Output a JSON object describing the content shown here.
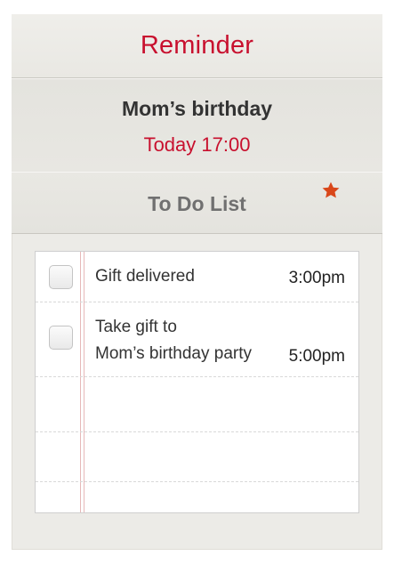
{
  "header": {
    "title": "Reminder"
  },
  "event": {
    "title": "Mom’s birthday",
    "time": "Today 17:00"
  },
  "todo": {
    "title": "To Do List",
    "star_icon": "star-icon",
    "star_color": "#d9471a",
    "items": [
      {
        "text_lines": [
          "Gift delivered"
        ],
        "time": "3:00pm",
        "checked": false
      },
      {
        "text_lines": [
          "Take gift to",
          "Mom’s birthday party"
        ],
        "time": "5:00pm",
        "checked": false
      }
    ]
  },
  "colors": {
    "accent": "#c8102e",
    "background": "#ecebe7"
  }
}
